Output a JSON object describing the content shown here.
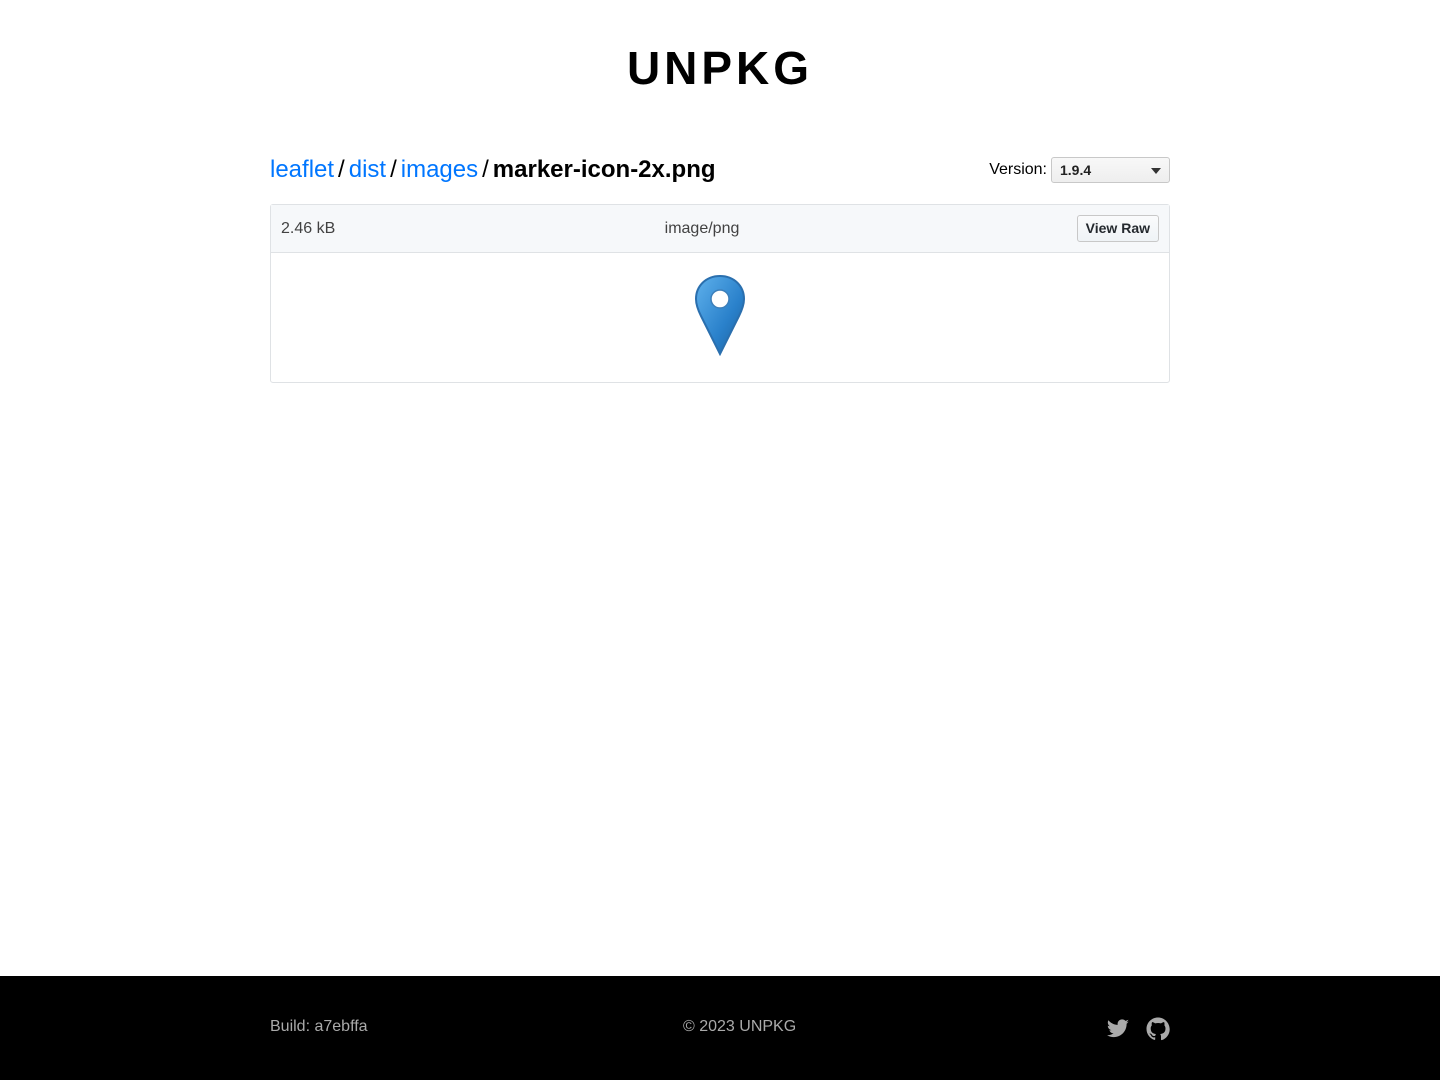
{
  "header": {
    "logo": "UNPKG"
  },
  "breadcrumb": {
    "items": [
      {
        "label": "leaflet"
      },
      {
        "label": "dist"
      },
      {
        "label": "images"
      }
    ],
    "separator": "/",
    "current": "marker-icon-2x.png"
  },
  "version": {
    "label": "Version:",
    "selected": "1.9.4"
  },
  "file": {
    "size": "2.46 kB",
    "type": "image/png",
    "view_raw_label": "View Raw",
    "preview_icon": "map-marker-icon",
    "marker_color": "#2a81cb"
  },
  "footer": {
    "build": "Build: a7ebffa",
    "copyright": "© 2023 UNPKG",
    "links": [
      {
        "icon": "twitter-icon"
      },
      {
        "icon": "github-icon"
      }
    ]
  },
  "colors": {
    "link": "#0076ff",
    "footer_bg": "#000000",
    "footer_text": "#aaaaaa"
  }
}
